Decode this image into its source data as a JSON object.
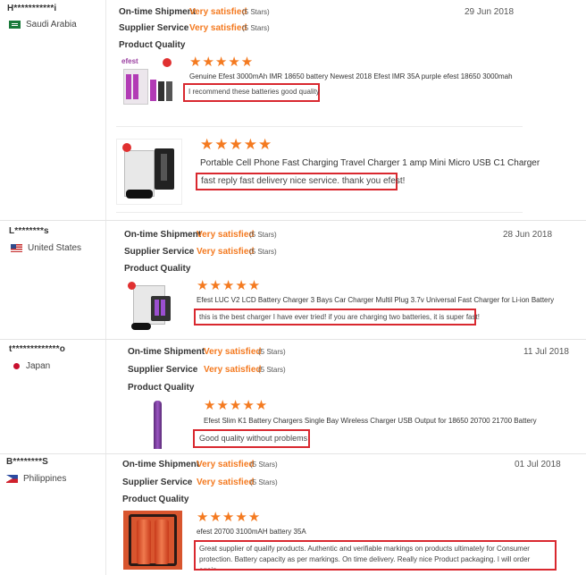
{
  "labels": {
    "shipment": "On-time Shipment",
    "service": "Supplier Service",
    "quality": "Product Quality"
  },
  "colors": {
    "accent": "#f47a20",
    "highlight_border": "#d9282f"
  },
  "reviews": [
    {
      "user": "H***********i",
      "country": "Saudi Arabia",
      "flag": "saudi-arabia-flag",
      "shipment": {
        "rating": "Very satisfied",
        "stars": "(5 Stars)"
      },
      "service": {
        "rating": "Very satisfied",
        "stars": "(5 Stars)"
      },
      "date": "29 Jun 2018",
      "products": [
        {
          "stars": "★★★★★",
          "star_count": 5,
          "name": "Genuine Efest 3000mAh IMR 18650 battery Newest 2018 Efest IMR 35A purple efest 18650 3000mah",
          "review": "I recommend these batteries good quality",
          "thumb_text": "efest"
        },
        {
          "stars": "★★★★★",
          "star_count": 5,
          "name": "Portable Cell Phone Fast Charging Travel Charger 1 amp Mini Micro USB C1 Charger",
          "review": "fast reply fast delivery nice service. thank you efest!"
        }
      ]
    },
    {
      "user": "L********s",
      "country": "United States",
      "flag": "united-states-flag",
      "shipment": {
        "rating": "Very satisfied",
        "stars": "(5 Stars)"
      },
      "service": {
        "rating": "Very satisfied",
        "stars": "(5 Stars)"
      },
      "date": "28 Jun 2018",
      "products": [
        {
          "stars": "★★★★★",
          "star_count": 5,
          "name": "Efest LUC V2 LCD Battery Charger 3 Bays Car Charger Multil Plug 3.7v Universal Fast Charger for Li-ion Battery",
          "review": "this is the best charger I have ever tried! if you are charging two batteries, it is super fast!"
        }
      ]
    },
    {
      "user": "t*************o",
      "country": "Japan",
      "flag": "japan-flag",
      "shipment": {
        "rating": "Very satisfied",
        "stars": "(5 Stars)"
      },
      "service": {
        "rating": "Very satisfied",
        "stars": "(5 Stars)"
      },
      "date": "11 Jul 2018",
      "products": [
        {
          "stars": "★★★★★",
          "star_count": 5,
          "name": "Efest Slim K1 Battery Chargers Single Bay Wireless Charger USB Output for 18650 20700 21700 Battery",
          "review": "Good quality without problems"
        }
      ]
    },
    {
      "user": "B********S",
      "country": "Philippines",
      "flag": "philippines-flag",
      "shipment": {
        "rating": "Very satisfied",
        "stars": "(5 Stars)"
      },
      "service": {
        "rating": "Very satisfied",
        "stars": "(5 Stars)"
      },
      "date": "01 Jul 2018",
      "products": [
        {
          "stars": "★★★★★",
          "star_count": 5,
          "name": "efest 20700 3100mAH battery 35A",
          "review": "Great supplier of qualify products. Authentic and verifiable markings on products ultimately for Consumer protection. Battery capacity as per markings. On time delivery. Really nice Product packaging. I will order again."
        }
      ]
    }
  ]
}
